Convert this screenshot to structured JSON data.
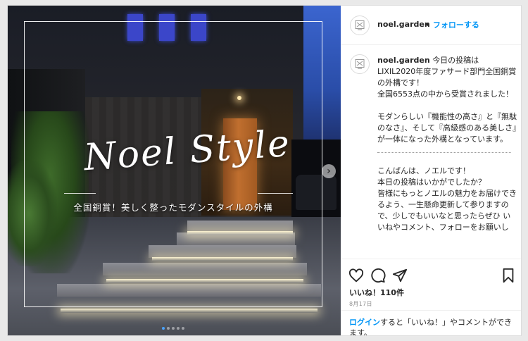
{
  "media": {
    "overlay_title": "Noel Style",
    "overlay_caption": "全国銅賞！美しく整ったモダンスタイルの外構",
    "carousel_dots": 5,
    "active_dot": 0,
    "next_icon": "chevron-right-icon"
  },
  "header": {
    "username": "noel.garden",
    "separator": "•",
    "follow_label": "フォローする",
    "avatar_icon": "noel-logo-icon"
  },
  "caption": {
    "username": "noel.garden",
    "paragraph1": "今日の投稿はLIXIL2020年度ファサード部門全国銅賞の外構です！\n全国6553点の中から受賞されました！",
    "paragraph2": "モダンらしい『機能性の高さ』と『無駄のなさ』、そして『高級感のある美しさ』が一体になった外構となっています。",
    "paragraph3": "こんばんは、ノエルです！\n本日の投稿はいかがでしたか？\n皆様にもっとノエルの魅力をお届けできるよう、一生懸命更新して参りますので、少しでもいいなと思ったらぜひ いいねやコメント、フォローをお願いし"
  },
  "actions": {
    "like_icon": "heart-icon",
    "comment_icon": "comment-icon",
    "share_icon": "share-icon",
    "save_icon": "bookmark-icon",
    "likes_text": "いいね！110件",
    "date_text": "8月17日"
  },
  "login": {
    "link_text": "ログイン",
    "rest_text": "すると「いいね！」やコメントができます。"
  },
  "colors": {
    "link": "#0095f6",
    "text": "#262626",
    "muted": "#8e8e8e",
    "border": "#dbdbdb"
  }
}
